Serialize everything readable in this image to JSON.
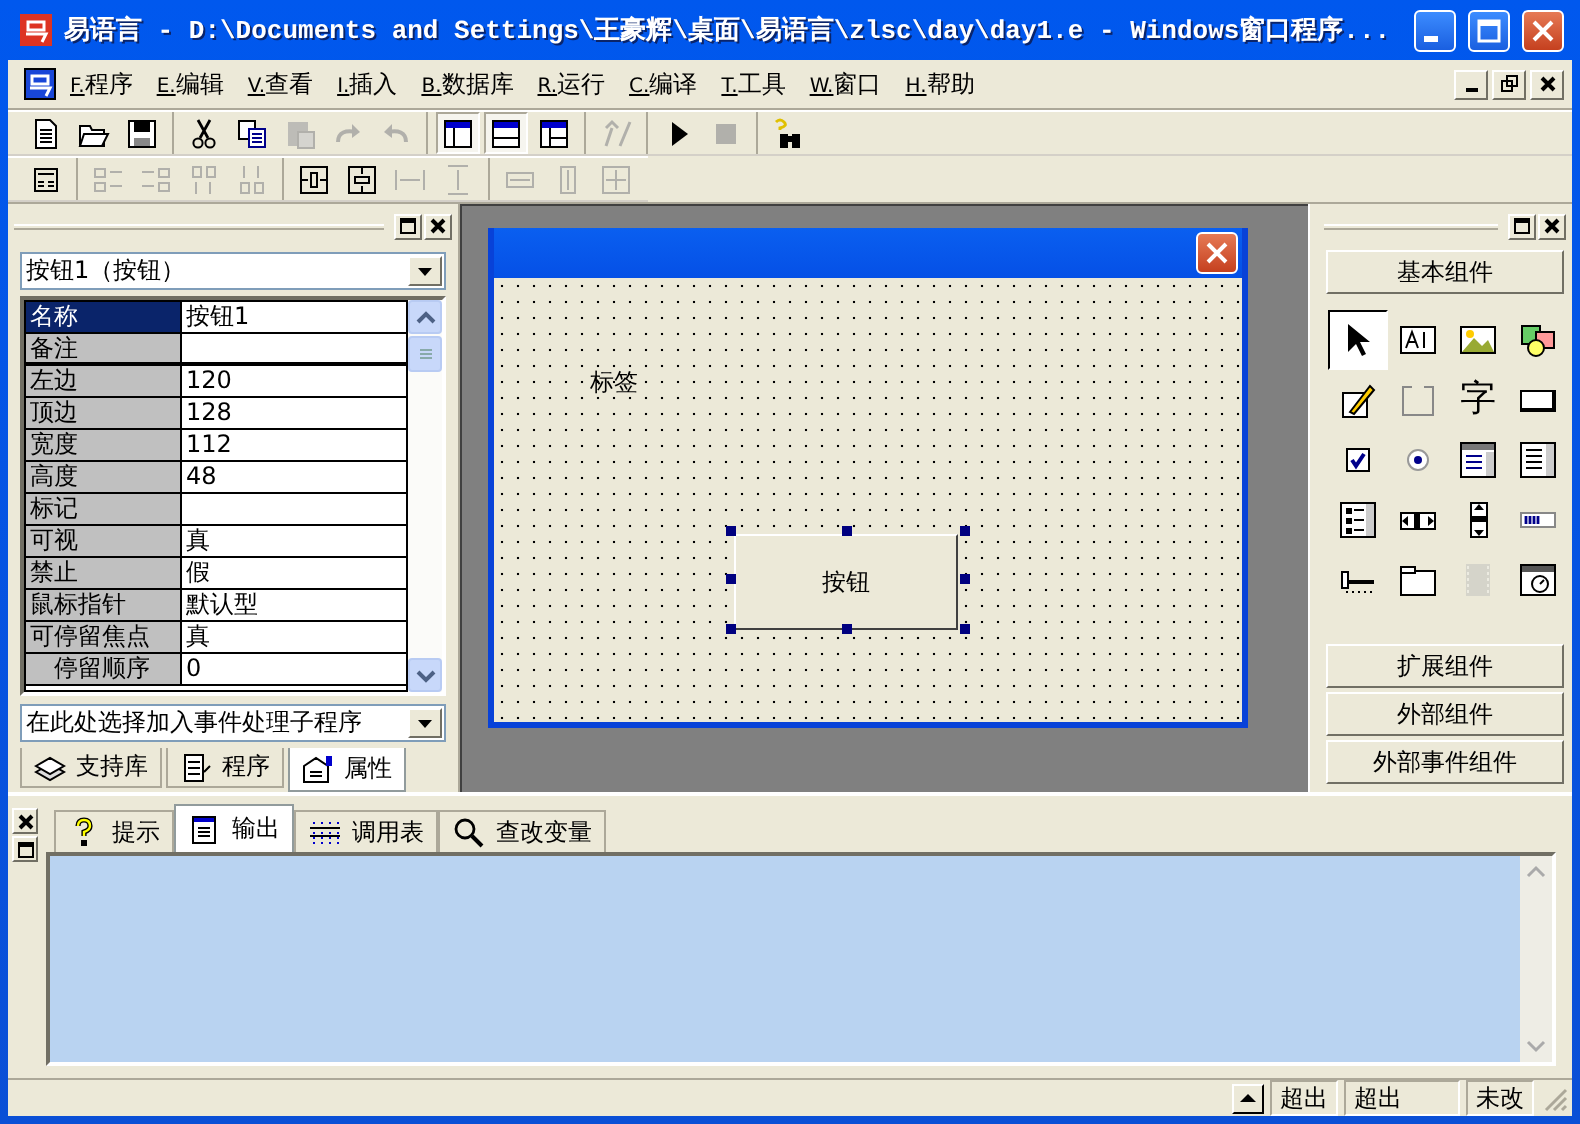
{
  "window": {
    "title": "易语言 - D:\\Documents and Settings\\王豪辉\\桌面\\易语言\\zlsc\\day\\day1.e - Windows窗口程序..."
  },
  "menu": [
    "F.程序",
    "E.编辑",
    "V.查看",
    "I.插入",
    "B.数据库",
    "R.运行",
    "C.编译",
    "T.工具",
    "W.窗口",
    "H.帮助"
  ],
  "toolbars": [
    {
      "groups": [
        [
          {
            "kind": "new",
            "disabled": false,
            "pressed": false
          },
          {
            "kind": "open",
            "disabled": false,
            "pressed": false
          },
          {
            "kind": "save",
            "disabled": false,
            "pressed": false
          }
        ],
        [
          {
            "kind": "cut",
            "disabled": false,
            "pressed": false
          },
          {
            "kind": "copy",
            "disabled": false,
            "pressed": false
          },
          {
            "kind": "paste",
            "disabled": true,
            "pressed": false
          },
          {
            "kind": "redo",
            "disabled": true,
            "pressed": false
          },
          {
            "kind": "undo",
            "disabled": true,
            "pressed": false
          }
        ],
        [
          {
            "kind": "layout-a",
            "disabled": false,
            "pressed": true
          },
          {
            "kind": "layout-b",
            "disabled": false,
            "pressed": true
          },
          {
            "kind": "layout-c",
            "disabled": false,
            "pressed": false
          }
        ],
        [
          {
            "kind": "wand",
            "disabled": true,
            "pressed": false
          }
        ],
        [
          {
            "kind": "run",
            "disabled": false,
            "pressed": false
          },
          {
            "kind": "stop",
            "disabled": true,
            "pressed": false
          }
        ],
        [
          {
            "kind": "find",
            "disabled": false,
            "pressed": false
          }
        ]
      ]
    },
    {
      "groups": [
        [
          {
            "kind": "grid",
            "disabled": false,
            "pressed": false
          }
        ],
        [
          {
            "kind": "align-left",
            "disabled": true,
            "pressed": false
          },
          {
            "kind": "align-right",
            "disabled": true,
            "pressed": false
          },
          {
            "kind": "align-top",
            "disabled": true,
            "pressed": false
          },
          {
            "kind": "align-bottom",
            "disabled": true,
            "pressed": false
          }
        ],
        [
          {
            "kind": "center-h",
            "disabled": false,
            "pressed": false
          },
          {
            "kind": "center-v",
            "disabled": false,
            "pressed": false
          },
          {
            "kind": "space-h",
            "disabled": true,
            "pressed": false
          },
          {
            "kind": "space-v",
            "disabled": true,
            "pressed": false
          }
        ],
        [
          {
            "kind": "same-width",
            "disabled": true,
            "pressed": false
          },
          {
            "kind": "same-height",
            "disabled": true,
            "pressed": false
          },
          {
            "kind": "same-size",
            "disabled": true,
            "pressed": false
          }
        ]
      ]
    }
  ],
  "properties": {
    "object_selector": "按钮1（按钮）",
    "rows": [
      {
        "name": "名称",
        "value": "按钮1",
        "selected": true
      },
      {
        "name": "备注",
        "value": "",
        "selected": false
      },
      {
        "name": "左边",
        "value": "120",
        "selected": false
      },
      {
        "name": "顶边",
        "value": "128",
        "selected": false
      },
      {
        "name": "宽度",
        "value": "112",
        "selected": false
      },
      {
        "name": "高度",
        "value": "48",
        "selected": false
      },
      {
        "name": "标记",
        "value": "",
        "selected": false
      },
      {
        "name": "可视",
        "value": "真",
        "selected": false
      },
      {
        "name": "禁止",
        "value": "假",
        "selected": false
      },
      {
        "name": "鼠标指针",
        "value": "默认型",
        "selected": false
      },
      {
        "name": "可停留焦点",
        "value": "真",
        "selected": false
      },
      {
        "name": "停留顺序",
        "value": "0",
        "selected": false
      }
    ],
    "event_selector": "在此处选择加入事件处理子程序",
    "tabs": [
      {
        "label": "支持库",
        "kind": "library",
        "selected": false
      },
      {
        "label": "程序",
        "kind": "program",
        "selected": false
      },
      {
        "label": "属性",
        "kind": "properties",
        "selected": true
      }
    ]
  },
  "designer": {
    "label": "标签",
    "button": "按钮"
  },
  "palette": {
    "header": "基本组件",
    "tools": [
      {
        "kind": "pointer",
        "selected": true,
        "disabled": false
      },
      {
        "kind": "label",
        "selected": false,
        "disabled": false
      },
      {
        "kind": "picture",
        "selected": false,
        "disabled": false
      },
      {
        "kind": "shape",
        "selected": false,
        "disabled": false
      },
      {
        "kind": "edit",
        "selected": false,
        "disabled": false
      },
      {
        "kind": "group",
        "selected": false,
        "disabled": false
      },
      {
        "kind": "glyph",
        "glyph": "字",
        "selected": false,
        "disabled": false
      },
      {
        "kind": "button",
        "selected": false,
        "disabled": false
      },
      {
        "kind": "checkbox",
        "selected": false,
        "disabled": false
      },
      {
        "kind": "radio",
        "selected": false,
        "disabled": false
      },
      {
        "kind": "combo",
        "selected": false,
        "disabled": false
      },
      {
        "kind": "list",
        "selected": false,
        "disabled": false
      },
      {
        "kind": "checklist",
        "selected": false,
        "disabled": false
      },
      {
        "kind": "hscroll",
        "selected": false,
        "disabled": false
      },
      {
        "kind": "vscroll",
        "selected": false,
        "disabled": false
      },
      {
        "kind": "progress",
        "selected": false,
        "disabled": false
      },
      {
        "kind": "slider",
        "selected": false,
        "disabled": false
      },
      {
        "kind": "tabs",
        "selected": false,
        "disabled": false
      },
      {
        "kind": "film",
        "selected": false,
        "disabled": true
      },
      {
        "kind": "timer",
        "selected": false,
        "disabled": false
      }
    ],
    "buttons": [
      "扩展组件",
      "外部组件",
      "外部事件组件"
    ]
  },
  "output": {
    "tabs": [
      {
        "label": "提示",
        "kind": "hint",
        "selected": false
      },
      {
        "label": "输出",
        "kind": "output",
        "selected": true
      },
      {
        "label": "调用表",
        "kind": "calls",
        "selected": false
      },
      {
        "label": "查改变量",
        "kind": "watch",
        "selected": false
      }
    ]
  },
  "status_bar": {
    "panels": [
      "超出",
      "超出",
      "未改"
    ]
  }
}
